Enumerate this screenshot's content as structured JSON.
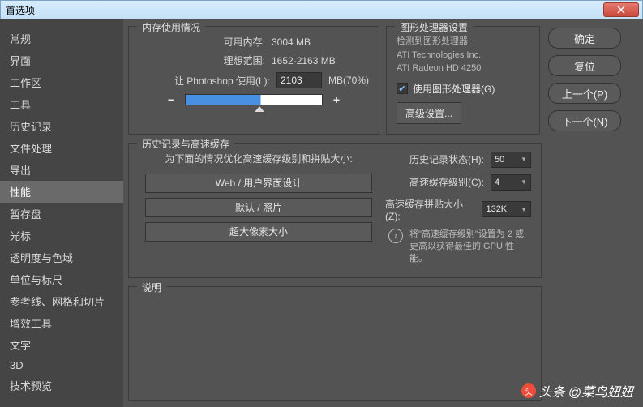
{
  "window": {
    "title": "首选项"
  },
  "sidebar": {
    "items": [
      {
        "label": "常规"
      },
      {
        "label": "界面"
      },
      {
        "label": "工作区"
      },
      {
        "label": "工具"
      },
      {
        "label": "历史记录"
      },
      {
        "label": "文件处理"
      },
      {
        "label": "导出"
      },
      {
        "label": "性能"
      },
      {
        "label": "暂存盘"
      },
      {
        "label": "光标"
      },
      {
        "label": "透明度与色域"
      },
      {
        "label": "单位与标尺"
      },
      {
        "label": "参考线、网格和切片"
      },
      {
        "label": "增效工具"
      },
      {
        "label": "文字"
      },
      {
        "label": "3D"
      },
      {
        "label": "技术预览"
      }
    ],
    "active_index": 7
  },
  "memory": {
    "group_title": "内存使用情况",
    "available_label": "可用内存:",
    "available_value": "3004 MB",
    "ideal_label": "理想范围:",
    "ideal_value": "1652-2163 MB",
    "ps_use_label": "让 Photoshop 使用(L):",
    "ps_use_value": "2103",
    "ps_use_suffix": "MB(70%)",
    "minus": "−",
    "plus": "+"
  },
  "gpu": {
    "group_title": "图形处理器设置",
    "detected_label": "检测到图形处理器:",
    "vendor": "ATI Technologies Inc.",
    "model": "ATI Radeon HD 4250",
    "use_gpu_label": "使用图形处理器(G)",
    "use_gpu_checked": true,
    "advanced_btn": "高级设置..."
  },
  "history": {
    "group_title": "历史记录与高速缓存",
    "note": "为下面的情况优化高速缓存级别和拼贴大小:",
    "btn1": "Web / 用户界面设计",
    "btn2": "默认 / 照片",
    "btn3": "超大像素大小",
    "states_label": "历史记录状态(H):",
    "states_value": "50",
    "cache_level_label": "高速缓存级别(C):",
    "cache_level_value": "4",
    "tile_size_label": "高速缓存拼贴大小(Z):",
    "tile_size_value": "132K",
    "info_text": "将\"高速缓存级别\"设置为 2 或更高以获得最佳的 GPU 性能。"
  },
  "desc": {
    "title": "说明"
  },
  "buttons": {
    "ok": "确定",
    "reset": "复位",
    "prev": "上一个(P)",
    "next": "下一个(N)"
  },
  "watermark": {
    "prefix": "头条",
    "author": "@菜鸟妞妞"
  }
}
